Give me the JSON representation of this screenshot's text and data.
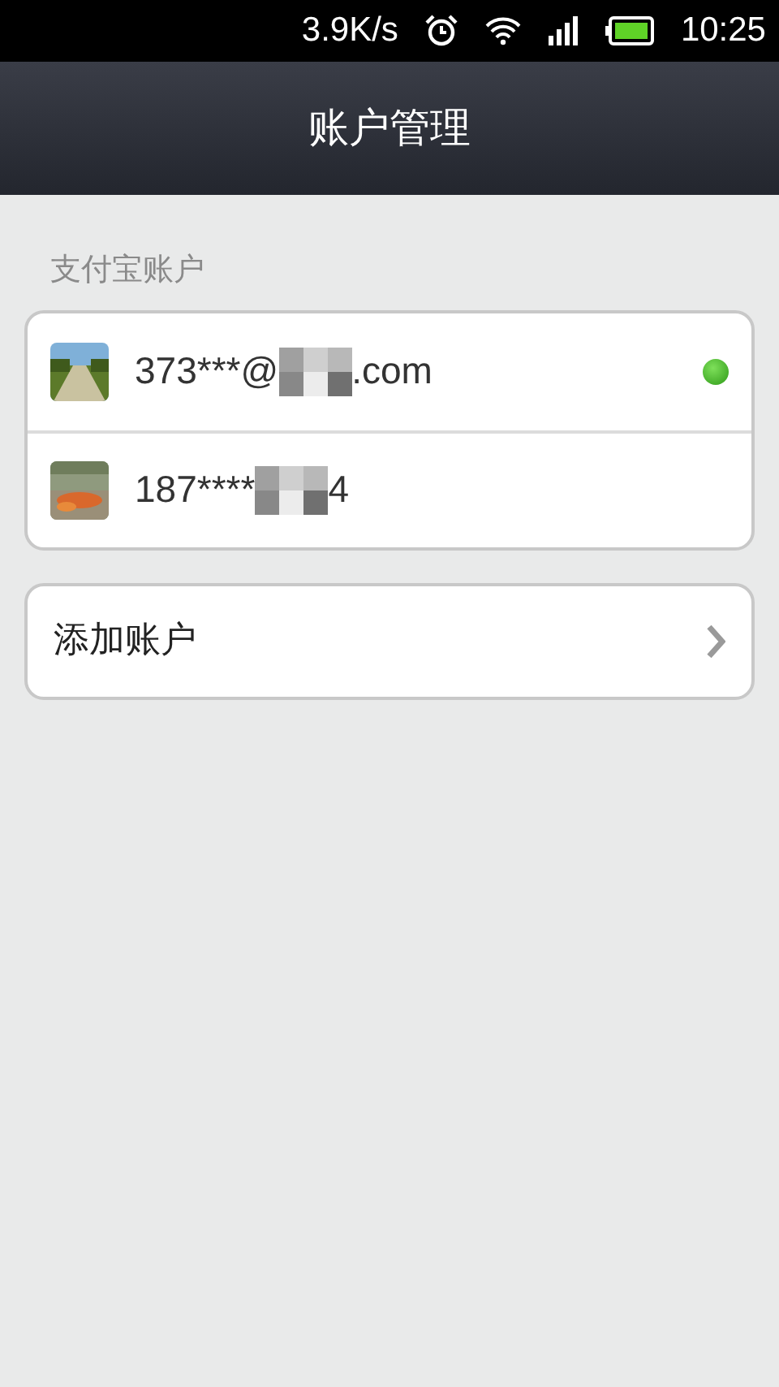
{
  "status_bar": {
    "speed": "3.9K/s",
    "time": "10:25"
  },
  "header": {
    "title": "账户管理"
  },
  "section_title": "支付宝账户",
  "accounts": [
    {
      "prefix": "373***@",
      "suffix": ".com",
      "active": true
    },
    {
      "prefix": "187****",
      "suffix": "4",
      "active": false
    }
  ],
  "add_account": {
    "label": "添加账户"
  }
}
